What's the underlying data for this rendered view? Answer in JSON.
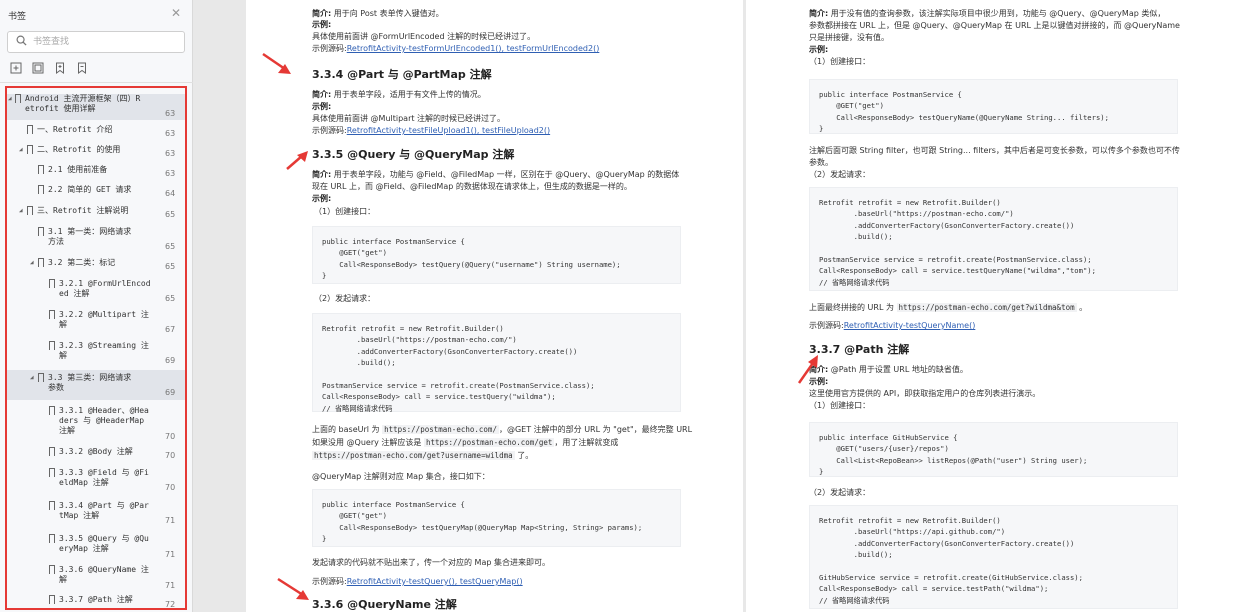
{
  "sidebar": {
    "title": "书签",
    "search_placeholder": "书签查找",
    "toc": [
      {
        "label": "Android 主流开源框架（四）R\netrofit 使用详解",
        "page": "63"
      },
      {
        "label": "一、Retrofit 介绍",
        "page": "63"
      },
      {
        "label": "二、Retrofit 的使用",
        "page": "63"
      },
      {
        "label": "2.1 使用前准备",
        "page": "63"
      },
      {
        "label": "2.2 简单的 GET 请求",
        "page": "64"
      },
      {
        "label": "三、Retrofit 注解说明",
        "page": "65"
      },
      {
        "label": "3.1 第一类：网络请求\n方法",
        "page": "65"
      },
      {
        "label": "3.2 第二类：标记",
        "page": "65"
      },
      {
        "label": "3.2.1 @FormUrlEncod\ned 注解",
        "page": "65"
      },
      {
        "label": "3.2.2 @Multipart 注\n解",
        "page": "67"
      },
      {
        "label": "3.2.3 @Streaming 注\n解",
        "page": "69"
      },
      {
        "label": "3.3 第三类：网络请求\n参数",
        "page": "69"
      },
      {
        "label": "3.3.1 @Header、@Hea\nders 与 @HeaderMap\n注解",
        "page": "70"
      },
      {
        "label": "3.3.2 @Body 注解",
        "page": "70"
      },
      {
        "label": "3.3.3 @Field 与 @Fi\neldMap 注解",
        "page": "70"
      },
      {
        "label": "3.3.4 @Part 与 @Par\ntMap 注解",
        "page": "71"
      },
      {
        "label": "3.3.5 @Query 与 @Qu\neryMap 注解",
        "page": "71"
      },
      {
        "label": "3.3.6 @QueryName 注\n解",
        "page": "71"
      },
      {
        "label": "3.3.7 @Path 注解",
        "page": "72"
      }
    ]
  },
  "page1": {
    "l_intro": "简介:",
    "l_example": "示例:",
    "l_source": "示例源码:",
    "l1_text": "用于向 Post 表单传入键值对。",
    "l3": "具体使用前面讲 @FormUrlEncoded 注解的时候已经讲过了。",
    "l4_link": "RetrofitActivity-testFormUrlEncoded1(), testFormUrlEncoded2()",
    "h334": "3.3.4 @Part 与 @PartMap 注解",
    "l5_text": "用于表单字段，适用于有文件上传的情况。",
    "l7": "具体使用前面讲 @Multipart 注解的时候已经讲过了。",
    "l8_link": "RetrofitActivity-testFileUpload1(), testFileUpload2()",
    "h335": "3.3.5 @Query 与 @QueryMap 注解",
    "l9_text": "用于表单字段，功能与 @Field、@FiledMap 一样，区别在于 @Query、@QueryMap 的数据体",
    "l10": "现在 URL 上，而 @Field、@FiledMap 的数据体现在请求体上，但生成的数据是一样的。",
    "l12": "（1）创建接口：",
    "code1": "public interface PostmanService {\n    @GET(\"get\")\n    Call<ResponseBody> testQuery(@Query(\"username\") String username);\n}",
    "l13": "（2）发起请求：",
    "code2": "Retrofit retrofit = new Retrofit.Builder()\n        .baseUrl(\"https://postman-echo.com/\")\n        .addConverterFactory(GsonConverterFactory.create())\n        .build();\n\nPostmanService service = retrofit.create(PostmanService.class);\nCall<ResponseBody> call = service.testQuery(\"wildma\");\n// 省略网络请求代码",
    "l14_a": "上面的 baseUrl 为",
    "l14_b": "https://postman-echo.com/",
    "l14_c": "，@GET 注解中的部分 URL 为 \"get\"，最终完整 URL",
    "l15_a": "如果没用 @Query 注解应该是",
    "l15_b": "https://postman-echo.com/get",
    "l15_c": "，用了注解就变成",
    "l16_a": "https://postman-echo.com/get?username=wildma",
    "l16_b": "了。",
    "l17": "@QueryMap 注解则对应 Map 集合，接口如下：",
    "code3": "public interface PostmanService {\n    @GET(\"get\")\n    Call<ResponseBody> testQueryMap(@QueryMap Map<String, String> params);\n}",
    "l18": "发起请求的代码就不贴出来了，传一个对应的 Map 集合进来即可。",
    "l19_link": "RetrofitActivity-testQuery(), testQueryMap()",
    "h336": "3.3.6 @QueryName 注解"
  },
  "page2": {
    "l_intro": "简介:",
    "l_example": "示例:",
    "l_source": "示例源码:",
    "l1_text": "用于没有值的查询参数，该注解实际项目中很少用到，功能与 @Query、@QueryMap 类似，",
    "l2": "参数都拼接在 URL 上，但是 @Query、@QueryMap 在 URL 上是以键值对拼接的，而 @QueryName",
    "l3": "只是拼接键，没有值。",
    "l5": "（1）创建接口：",
    "code1": "public interface PostmanService {\n    @GET(\"get\")\n    Call<ResponseBody> testQueryName(@QueryName String... filters);\n}",
    "l6": "注解后面可跟 String filter，也可跟 String... filters，其中后者是可变长参数，可以传多个参数也可不传",
    "l7": "参数。",
    "l8": "（2）发起请求：",
    "code2": "Retrofit retrofit = new Retrofit.Builder()\n        .baseUrl(\"https://postman-echo.com/\")\n        .addConverterFactory(GsonConverterFactory.create())\n        .build();\n\nPostmanService service = retrofit.create(PostmanService.class);\nCall<ResponseBody> call = service.testQueryName(\"wildma\",\"tom\");\n// 省略网络请求代码",
    "l9_a": "上面最终拼接的 URL 为",
    "l9_b": "https://postman-echo.com/get?wildma&tom",
    "l9_c": "。",
    "l10_link": "RetrofitActivity-testQueryName()",
    "h337": "3.3.7 @Path 注解",
    "l11_text": "@Path 用于设置 URL 地址的缺省值。",
    "l13": "这里使用官方提供的 API，即获取指定用户的仓库列表进行演示。",
    "l14": "（1）创建接口：",
    "code3": "public interface GitHubService {\n    @GET(\"users/{user}/repos\")\n    Call<List<RepoBean>> listRepos(@Path(\"user\") String user);\n}",
    "l15": "（2）发起请求：",
    "code4": "Retrofit retrofit = new Retrofit.Builder()\n        .baseUrl(\"https://api.github.com/\")\n        .addConverterFactory(GsonConverterFactory.create())\n        .build();\n\nGitHubService service = retrofit.create(GitHubService.class);\nCall<ResponseBody> call = service.testPath(\"wildma\");\n// 省略网络请求代码"
  }
}
